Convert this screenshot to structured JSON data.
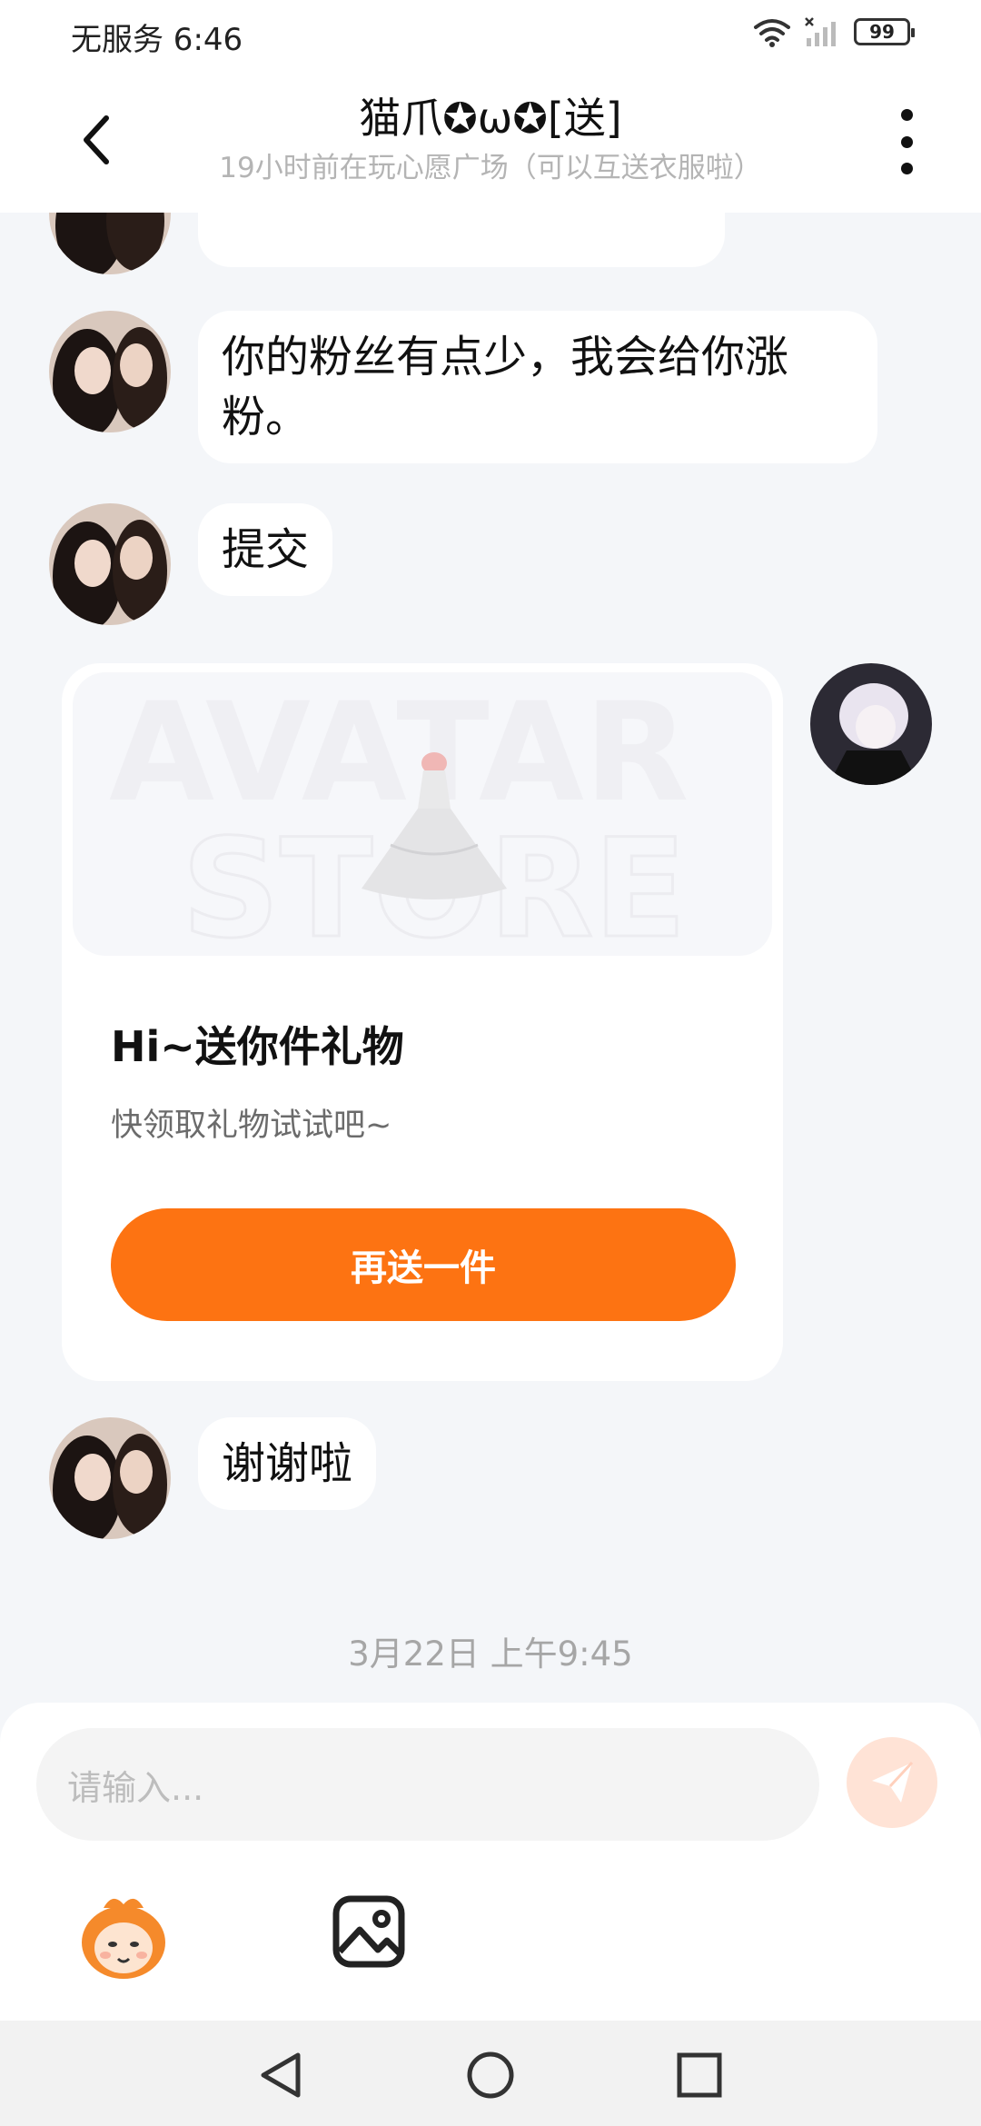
{
  "status_bar": {
    "left_text": "无服务 6:46",
    "battery_level": "99",
    "icons": [
      "wifi-icon",
      "signal-icon",
      "battery-icon"
    ]
  },
  "header": {
    "title": "猫爪✪ω✪[送]",
    "subtitle": "19小时前在玩心愿广场（可以互送衣服啦）",
    "icons": [
      "back-icon",
      "more-icon"
    ]
  },
  "messages": [
    {
      "id": "m2",
      "sender": "other",
      "text": "你的粉丝有点少，我会给你涨粉。"
    },
    {
      "id": "m3",
      "sender": "other",
      "text": "提交"
    },
    {
      "id": "m4",
      "sender": "self",
      "type": "gift_card"
    },
    {
      "id": "m5",
      "sender": "other",
      "text": "谢谢啦"
    }
  ],
  "gift_card": {
    "title": "Hi~送你件礼物",
    "description": "快领取礼物试试吧~",
    "button_label": "再送一件",
    "watermark_line1": "AVATAR",
    "watermark_line2": "STORE"
  },
  "timestamp": "3月22日 上午9:45",
  "input": {
    "placeholder": "请输入..."
  },
  "colors": {
    "accent": "#fd7312",
    "send_button_disabled": "#ffe3d6",
    "chat_background": "#f4f6f9",
    "bubble_background": "#ffffff"
  },
  "toolbar_icons": [
    "mascot-emoji-icon",
    "image-icon"
  ],
  "nav_icons": [
    "nav-back-icon",
    "nav-home-icon",
    "nav-recents-icon"
  ]
}
